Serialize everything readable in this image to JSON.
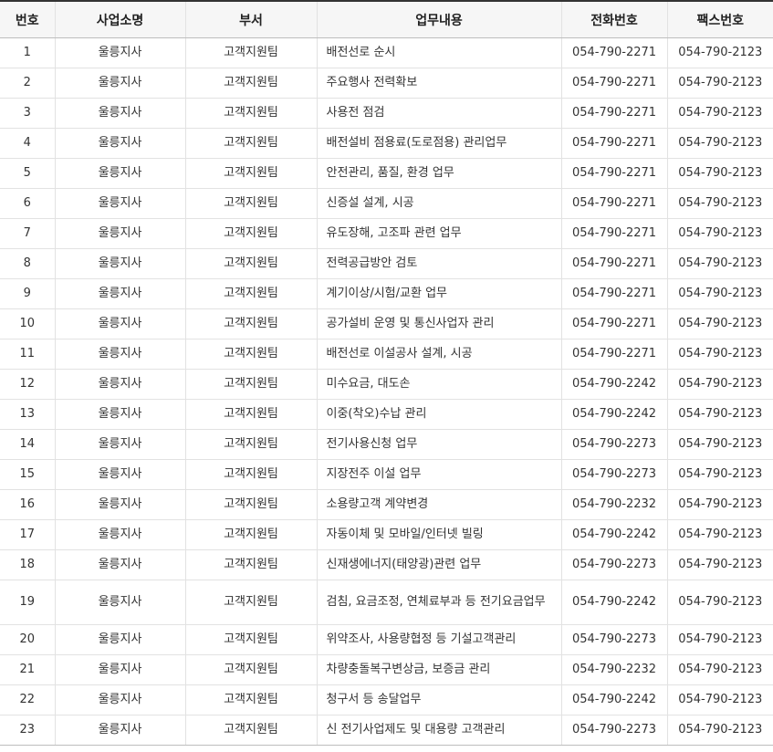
{
  "headers": [
    "번호",
    "사업소명",
    "부서",
    "업무내용",
    "전화번호",
    "팩스번호"
  ],
  "rows": [
    {
      "no": "1",
      "office": "울릉지사",
      "dept": "고객지원팀",
      "work": "배전선로 순시",
      "tel": "054-790-2271",
      "fax": "054-790-2123"
    },
    {
      "no": "2",
      "office": "울릉지사",
      "dept": "고객지원팀",
      "work": "주요행사 전력확보",
      "tel": "054-790-2271",
      "fax": "054-790-2123"
    },
    {
      "no": "3",
      "office": "울릉지사",
      "dept": "고객지원팀",
      "work": "사용전 점검",
      "tel": "054-790-2271",
      "fax": "054-790-2123"
    },
    {
      "no": "4",
      "office": "울릉지사",
      "dept": "고객지원팀",
      "work": "배전설비 점용료(도로점용) 관리업무",
      "tel": "054-790-2271",
      "fax": "054-790-2123"
    },
    {
      "no": "5",
      "office": "울릉지사",
      "dept": "고객지원팀",
      "work": "안전관리, 품질, 환경 업무",
      "tel": "054-790-2271",
      "fax": "054-790-2123"
    },
    {
      "no": "6",
      "office": "울릉지사",
      "dept": "고객지원팀",
      "work": "신증설 설계, 시공",
      "tel": "054-790-2271",
      "fax": "054-790-2123"
    },
    {
      "no": "7",
      "office": "울릉지사",
      "dept": "고객지원팀",
      "work": "유도장해, 고조파 관련 업무",
      "tel": "054-790-2271",
      "fax": "054-790-2123"
    },
    {
      "no": "8",
      "office": "울릉지사",
      "dept": "고객지원팀",
      "work": "전력공급방안 검토",
      "tel": "054-790-2271",
      "fax": "054-790-2123"
    },
    {
      "no": "9",
      "office": "울릉지사",
      "dept": "고객지원팀",
      "work": "계기이상/시험/교환 업무",
      "tel": "054-790-2271",
      "fax": "054-790-2123"
    },
    {
      "no": "10",
      "office": "울릉지사",
      "dept": "고객지원팀",
      "work": "공가설비 운영 및 통신사업자 관리",
      "tel": "054-790-2271",
      "fax": "054-790-2123"
    },
    {
      "no": "11",
      "office": "울릉지사",
      "dept": "고객지원팀",
      "work": "배전선로 이설공사 설계, 시공",
      "tel": "054-790-2271",
      "fax": "054-790-2123"
    },
    {
      "no": "12",
      "office": "울릉지사",
      "dept": "고객지원팀",
      "work": "미수요금, 대도손",
      "tel": "054-790-2242",
      "fax": "054-790-2123"
    },
    {
      "no": "13",
      "office": "울릉지사",
      "dept": "고객지원팀",
      "work": "이중(착오)수납 관리",
      "tel": "054-790-2242",
      "fax": "054-790-2123"
    },
    {
      "no": "14",
      "office": "울릉지사",
      "dept": "고객지원팀",
      "work": "전기사용신청 업무",
      "tel": "054-790-2273",
      "fax": "054-790-2123"
    },
    {
      "no": "15",
      "office": "울릉지사",
      "dept": "고객지원팀",
      "work": "지장전주 이설 업무",
      "tel": "054-790-2273",
      "fax": "054-790-2123"
    },
    {
      "no": "16",
      "office": "울릉지사",
      "dept": "고객지원팀",
      "work": "소용량고객 계약변경",
      "tel": "054-790-2232",
      "fax": "054-790-2123"
    },
    {
      "no": "17",
      "office": "울릉지사",
      "dept": "고객지원팀",
      "work": "자동이체 및 모바일/인터넷 빌링",
      "tel": "054-790-2242",
      "fax": "054-790-2123"
    },
    {
      "no": "18",
      "office": "울릉지사",
      "dept": "고객지원팀",
      "work": "신재생에너지(태양광)관련 업무",
      "tel": "054-790-2273",
      "fax": "054-790-2123"
    },
    {
      "no": "19",
      "office": "울릉지사",
      "dept": "고객지원팀",
      "work": "검침, 요금조정, 연체료부과 등 전기요금업무",
      "tel": "054-790-2242",
      "fax": "054-790-2123"
    },
    {
      "no": "20",
      "office": "울릉지사",
      "dept": "고객지원팀",
      "work": "위약조사, 사용량협정 등 기설고객관리",
      "tel": "054-790-2273",
      "fax": "054-790-2123"
    },
    {
      "no": "21",
      "office": "울릉지사",
      "dept": "고객지원팀",
      "work": "차량충돌복구변상금, 보증금 관리",
      "tel": "054-790-2232",
      "fax": "054-790-2123"
    },
    {
      "no": "22",
      "office": "울릉지사",
      "dept": "고객지원팀",
      "work": "청구서 등 송달업무",
      "tel": "054-790-2242",
      "fax": "054-790-2123"
    },
    {
      "no": "23",
      "office": "울릉지사",
      "dept": "고객지원팀",
      "work": "신 전기사업제도 및 대용량 고객관리",
      "tel": "054-790-2273",
      "fax": "054-790-2123"
    }
  ]
}
